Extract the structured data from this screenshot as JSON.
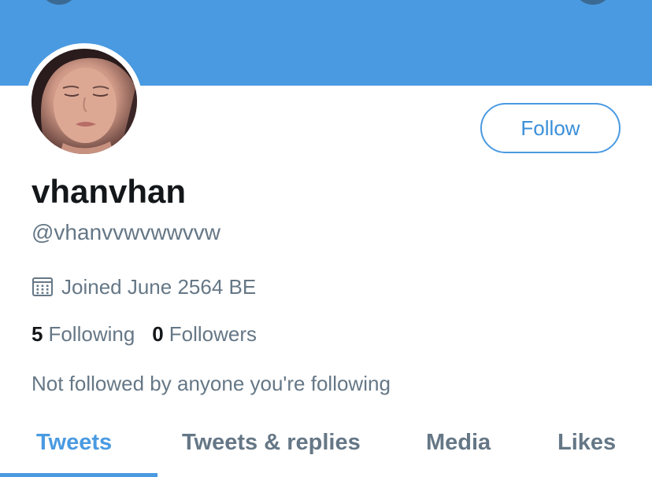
{
  "profile": {
    "display_name": "vhanvhan",
    "handle": "@vhanvvwvwwvvw",
    "joined": "Joined June 2564 BE",
    "following_count": "5",
    "following_label": "Following",
    "followers_count": "0",
    "followers_label": "Followers",
    "followed_by_note": "Not followed by anyone you're following"
  },
  "actions": {
    "follow_label": "Follow"
  },
  "tabs": [
    {
      "label": "Tweets",
      "active": true
    },
    {
      "label": "Tweets & replies",
      "active": false
    },
    {
      "label": "Media",
      "active": false
    },
    {
      "label": "Likes",
      "active": false
    }
  ],
  "icons": {
    "joined": "calendar-icon"
  },
  "colors": {
    "accent": "#4a9ae1",
    "banner": "#4a9ae1",
    "text_primary": "#14171a",
    "text_secondary": "#657786"
  }
}
